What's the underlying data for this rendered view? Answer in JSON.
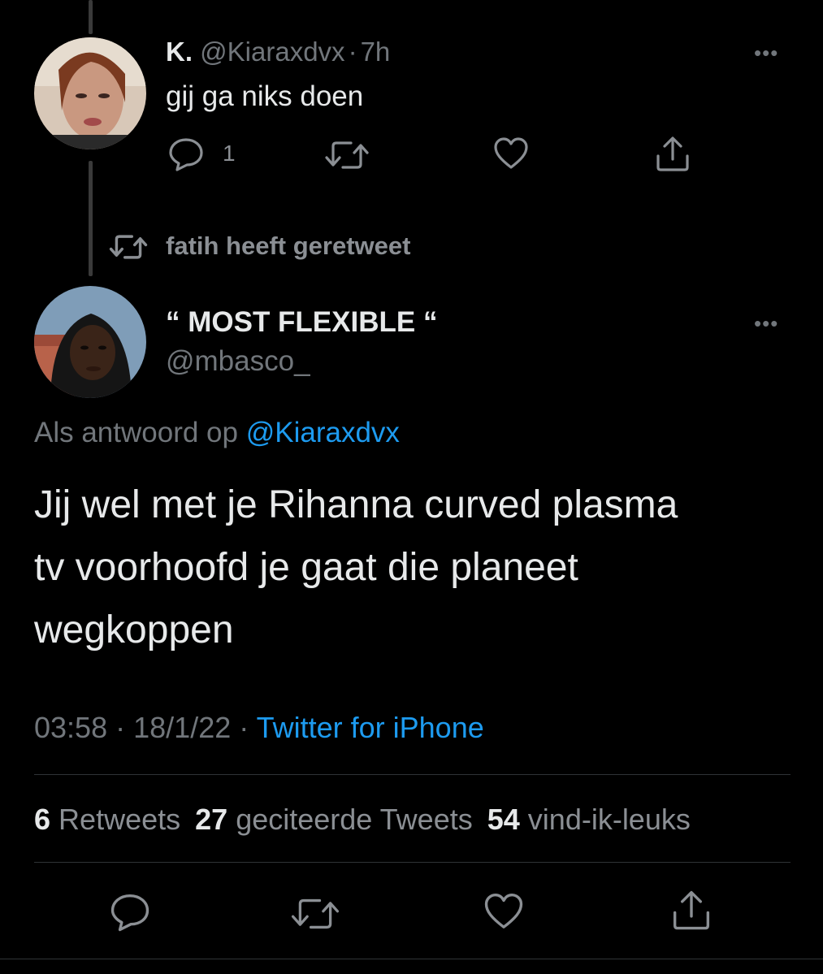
{
  "reply_tweet": {
    "display_name": "K.",
    "handle": "@Kiaraxdvx",
    "separator": "·",
    "time": "7h",
    "text": "gij ga niks doen",
    "reply_count": "1",
    "more_label": "•••"
  },
  "retweet_context": {
    "text": "fatih heeft geretweet"
  },
  "main_tweet": {
    "display_name": "“ MOST FLEXIBLE “",
    "handle": "@mbasco_",
    "more_label": "•••",
    "reply_prefix": "Als antwoord op",
    "reply_to": "@Kiaraxdvx",
    "text_line1": "Jij wel met je Rihanna curved plasma",
    "text_line2": "tv voorhoofd je gaat die planeet",
    "text_line3": "wegkoppen",
    "time": "03:58",
    "sep1": "·",
    "date": "18/1/22",
    "sep2": "·",
    "source": "Twitter for iPhone",
    "retweets_count": "6",
    "retweets_label": "Retweets",
    "quotes_count": "27",
    "quotes_label": "geciteerde Tweets",
    "likes_count": "54",
    "likes_label": "vind-ik-leuks"
  },
  "colors": {
    "background": "#000000",
    "text": "#e7e9ea",
    "muted": "#71767b",
    "link": "#1d9bf0"
  }
}
